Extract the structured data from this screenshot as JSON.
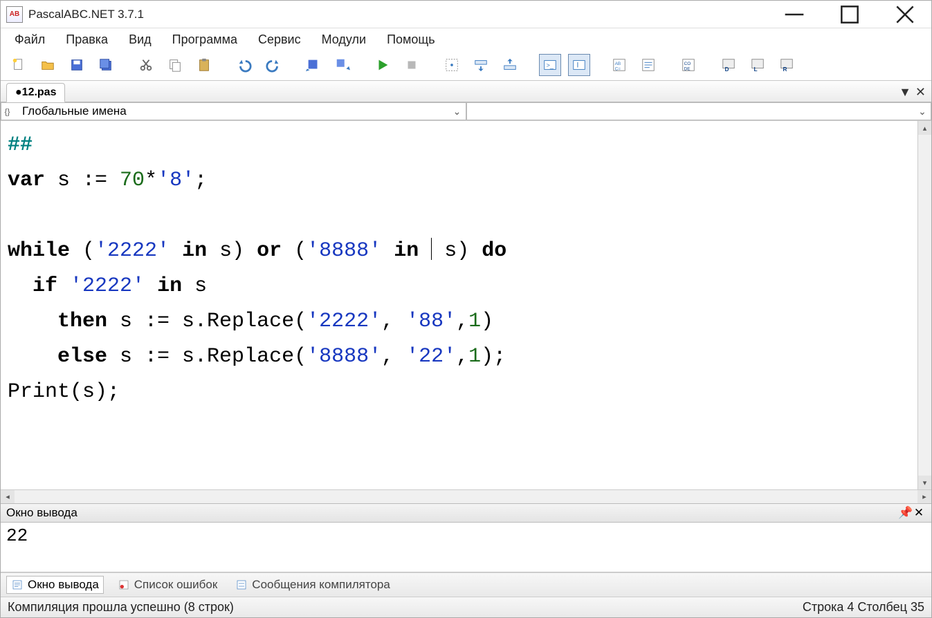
{
  "window": {
    "title": "PascalABC.NET 3.7.1",
    "app_icon_text": "AB"
  },
  "menu": {
    "items": [
      "Файл",
      "Правка",
      "Вид",
      "Программа",
      "Сервис",
      "Модули",
      "Помощь"
    ]
  },
  "toolbar": {
    "icons": [
      "new-file-icon",
      "open-file-icon",
      "save-icon",
      "save-all-icon",
      "cut-icon",
      "copy-icon",
      "paste-icon",
      "undo-icon",
      "redo-icon",
      "save-run-icon",
      "save-run-alt-icon",
      "run-icon",
      "stop-icon",
      "step-over-icon",
      "step-into-icon",
      "step-out-icon",
      "console-in-icon",
      "console-out-icon",
      "intellisense-icon",
      "brackets-icon",
      "code-icon",
      "design-d-icon",
      "design-l-icon",
      "design-r-icon"
    ]
  },
  "tabs": {
    "active": "●12.pas"
  },
  "namespace": {
    "label": "Глобальные имена"
  },
  "code": {
    "tokens": [
      [
        {
          "t": "##",
          "c": "teal"
        }
      ],
      [
        {
          "t": "var",
          "c": "kw"
        },
        {
          "t": " s := ",
          "c": "id"
        },
        {
          "t": "70",
          "c": "num"
        },
        {
          "t": "*",
          "c": "pun"
        },
        {
          "t": "'8'",
          "c": "str"
        },
        {
          "t": ";",
          "c": "pun"
        }
      ],
      [
        {
          "t": " ",
          "c": "id"
        }
      ],
      [
        {
          "t": "while",
          "c": "kw"
        },
        {
          "t": " (",
          "c": "pun"
        },
        {
          "t": "'2222'",
          "c": "str"
        },
        {
          "t": " ",
          "c": "id"
        },
        {
          "t": "in",
          "c": "kw"
        },
        {
          "t": " s) ",
          "c": "id"
        },
        {
          "t": "or",
          "c": "kw"
        },
        {
          "t": " (",
          "c": "pun"
        },
        {
          "t": "'8888'",
          "c": "str"
        },
        {
          "t": " ",
          "c": "id"
        },
        {
          "t": "in",
          "c": "kw"
        },
        {
          "t": " ",
          "c": "id"
        },
        {
          "t": "|",
          "c": "caret"
        },
        {
          "t": " s) ",
          "c": "id"
        },
        {
          "t": "do",
          "c": "kw"
        }
      ],
      [
        {
          "t": "  ",
          "c": "id"
        },
        {
          "t": "if",
          "c": "kw"
        },
        {
          "t": " ",
          "c": "id"
        },
        {
          "t": "'2222'",
          "c": "str"
        },
        {
          "t": " ",
          "c": "id"
        },
        {
          "t": "in",
          "c": "kw"
        },
        {
          "t": " s",
          "c": "id"
        }
      ],
      [
        {
          "t": "    ",
          "c": "id"
        },
        {
          "t": "then",
          "c": "kw"
        },
        {
          "t": " s := s.Replace(",
          "c": "id"
        },
        {
          "t": "'2222'",
          "c": "str"
        },
        {
          "t": ", ",
          "c": "pun"
        },
        {
          "t": "'88'",
          "c": "str"
        },
        {
          "t": ",",
          "c": "pun"
        },
        {
          "t": "1",
          "c": "num"
        },
        {
          "t": ")",
          "c": "pun"
        }
      ],
      [
        {
          "t": "    ",
          "c": "id"
        },
        {
          "t": "else",
          "c": "kw"
        },
        {
          "t": " s := s.Replace(",
          "c": "id"
        },
        {
          "t": "'8888'",
          "c": "str"
        },
        {
          "t": ", ",
          "c": "pun"
        },
        {
          "t": "'22'",
          "c": "str"
        },
        {
          "t": ",",
          "c": "pun"
        },
        {
          "t": "1",
          "c": "num"
        },
        {
          "t": ");",
          "c": "pun"
        }
      ],
      [
        {
          "t": "Print(s);",
          "c": "id"
        }
      ]
    ]
  },
  "output": {
    "title": "Окно вывода",
    "text": "22"
  },
  "bottom_tabs": {
    "active": "Окно вывода",
    "items": [
      "Окно вывода",
      "Список ошибок",
      "Сообщения компилятора"
    ]
  },
  "status": {
    "left": "Компиляция прошла успешно (8 строк)",
    "right": "Строка  4  Столбец  35"
  }
}
